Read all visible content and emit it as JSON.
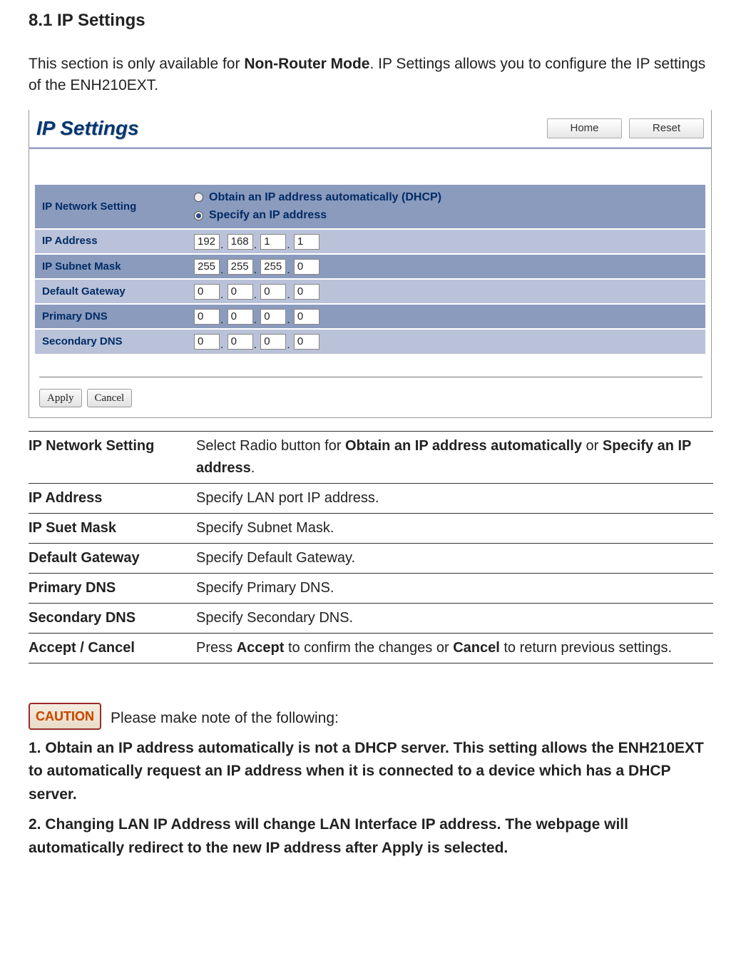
{
  "section_title": "8.1 IP Settings",
  "intro_before_bold": "This section is only available for ",
  "intro_bold": "Non-Router Mode",
  "intro_after_bold": ". IP Settings allows you to configure the IP settings of the ENH210EXT.",
  "panel": {
    "title": "IP Settings",
    "nav": {
      "home": "Home",
      "reset": "Reset"
    },
    "rows": {
      "network_setting_label": "IP Network Setting",
      "radio_dhcp": "Obtain an IP address automatically (DHCP)",
      "radio_specify": "Specify an IP address",
      "selected": "specify",
      "ip_address_label": "IP Address",
      "ip_address": [
        "192",
        "168",
        "1",
        "1"
      ],
      "subnet_label": "IP Subnet Mask",
      "subnet": [
        "255",
        "255",
        "255",
        "0"
      ],
      "gateway_label": "Default Gateway",
      "gateway": [
        "0",
        "0",
        "0",
        "0"
      ],
      "pdns_label": "Primary DNS",
      "pdns": [
        "0",
        "0",
        "0",
        "0"
      ],
      "sdns_label": "Secondary DNS",
      "sdns": [
        "0",
        "0",
        "0",
        "0"
      ]
    },
    "actions": {
      "apply": "Apply",
      "cancel": "Cancel"
    }
  },
  "desc": [
    {
      "term": "IP Network Setting",
      "text_pre": "Select Radio button for ",
      "b1": "Obtain an IP address automatically",
      "mid": " or ",
      "b2": "Specify an IP address",
      "post": "."
    },
    {
      "term": "IP Address",
      "plain": "Specify LAN port IP address."
    },
    {
      "term": "IP Suet Mask",
      "plain": "Specify Subnet Mask."
    },
    {
      "term": "Default Gateway",
      "plain": "Specify Default Gateway."
    },
    {
      "term": "Primary DNS",
      "plain": "Specify Primary DNS."
    },
    {
      "term": "Secondary DNS",
      "plain": "Specify Secondary DNS."
    },
    {
      "term": "Accept / Cancel",
      "text_pre": "Press ",
      "b1": "Accept",
      "mid": " to confirm the changes or ",
      "b2": "Cancel",
      "post": " to return previous settings."
    }
  ],
  "caution": {
    "badge": "CAUTION",
    "lead": "Please make note of the following:",
    "notes": [
      "1. Obtain an IP address automatically is not a DHCP server. This setting allows the ENH210EXT to automatically request an IP address when it is connected to a device which has a DHCP server.",
      "2. Changing LAN IP Address will change LAN Interface IP address. The webpage will automatically redirect to the new IP address after Apply is selected."
    ]
  }
}
